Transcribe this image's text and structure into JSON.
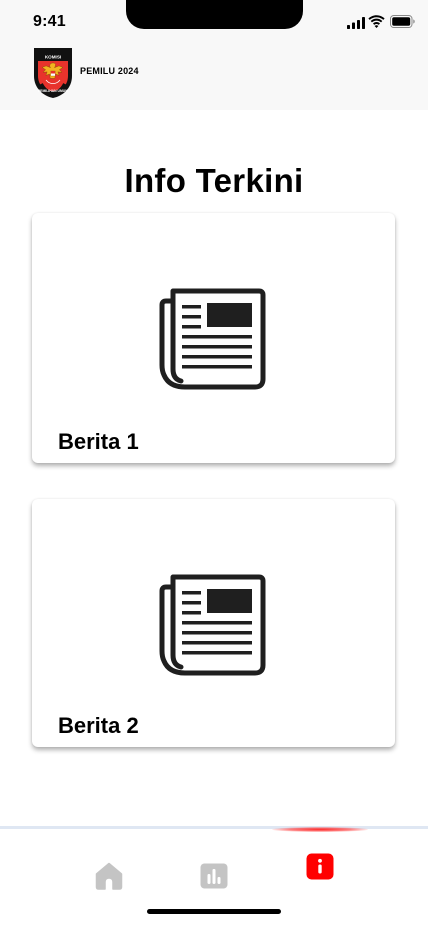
{
  "status_bar": {
    "time": "9:41"
  },
  "header": {
    "brand": "PEMILU 2024",
    "logo_top_text": "KOMISI",
    "logo_bottom_text": "PEMILIHAN UMUM"
  },
  "page": {
    "title": "Info Terkini"
  },
  "cards": [
    {
      "title": "Berita 1",
      "icon": "newspaper-icon"
    },
    {
      "title": "Berita 2",
      "icon": "newspaper-icon"
    }
  ],
  "bottom_nav": {
    "items": [
      {
        "icon": "home-icon",
        "active": false
      },
      {
        "icon": "bar-chart-icon",
        "active": false
      },
      {
        "icon": "info-icon",
        "active": true
      }
    ]
  },
  "colors": {
    "accent": "#ff0000",
    "inactive_icon": "#c4c4c4",
    "header_bg": "#f8f8f8",
    "nav_line": "#dfe7f3"
  }
}
